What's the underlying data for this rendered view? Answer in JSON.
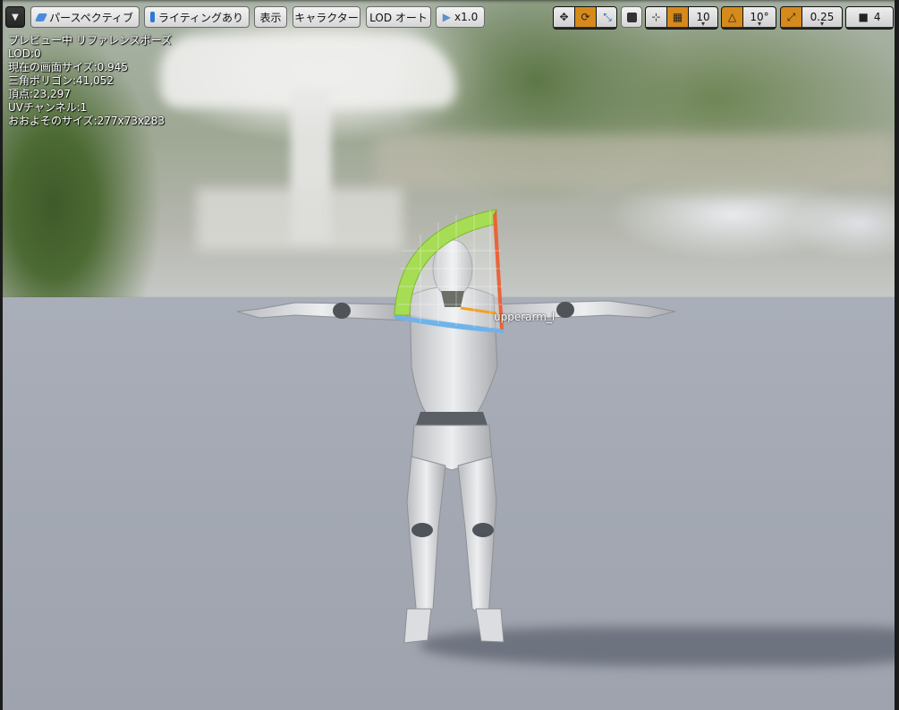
{
  "toolbar": {
    "perspective_label": "パースペクティブ",
    "lighting_label": "ライティングあり",
    "show_label": "表示",
    "character_label": "キャラクター",
    "lod_label": "LOD オート",
    "speed_label": "x1.0",
    "grid_snap_value": "10",
    "rotation_snap_value": "10°",
    "scale_snap_value": "0.25",
    "camera_speed_value": "4"
  },
  "stats": {
    "preview": "プレビュー中 リファレンスポーズ",
    "lod": "LOD:0",
    "screen_size": "現在の画面サイズ:0.945",
    "triangles": "三角ポリゴン:41,052",
    "vertices": "頂点:23,297",
    "uv_channels": "UVチャンネル:1",
    "approx_size": "おおよそのサイズ:277x73x283"
  },
  "bone_label": "upperarm_l",
  "colors": {
    "accent": "#d68a1b",
    "toolbar_bg": "#e2e2e2"
  }
}
